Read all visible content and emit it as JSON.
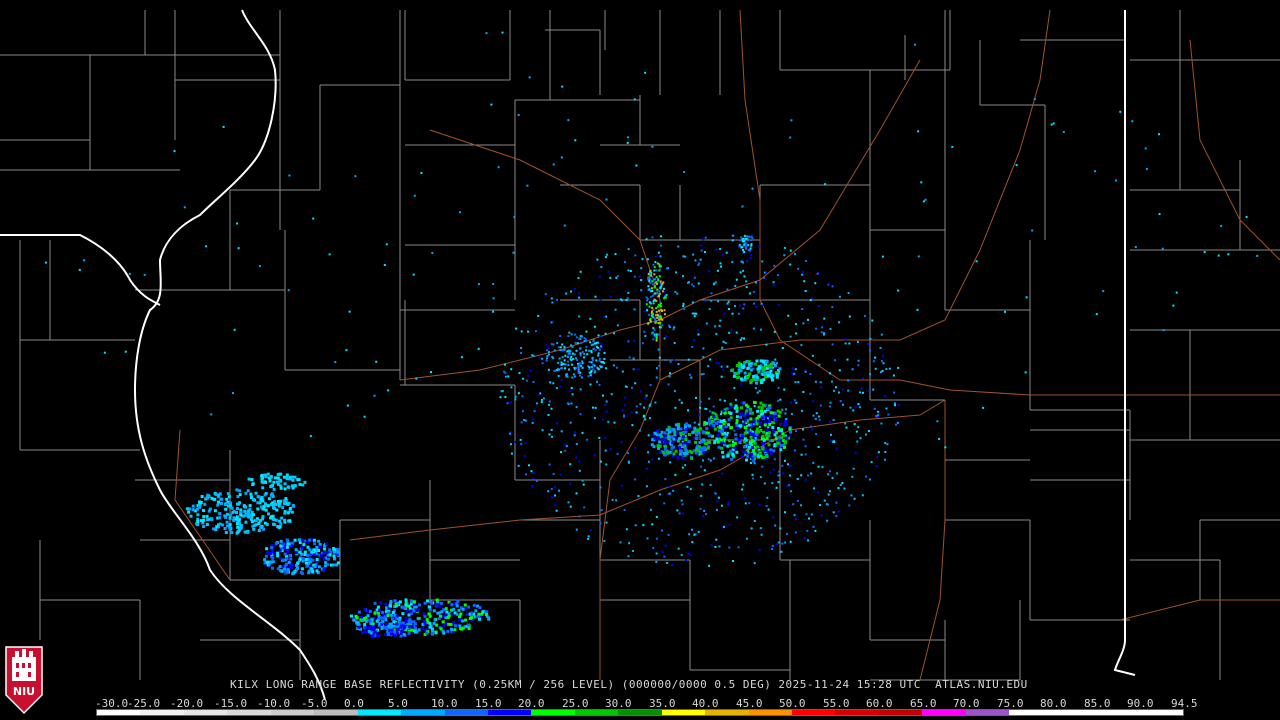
{
  "caption": "KILX LONG RANGE BASE REFLECTIVITY (0.25KM / 256 LEVEL) (000000/0000 0.5 DEG) 2025-11-24 15:28 UTC  ATLAS.NIU.EDU",
  "logo_text": "NIU",
  "colors": {
    "background": "#000000",
    "county_lines": "#8a8a8a",
    "state_lines": "#ffffff",
    "highways": "#a0522d",
    "text": "#d8d8d8"
  },
  "scale": {
    "labels": [
      "-30.0",
      "-25.0",
      "-20.0",
      "-15.0",
      "-10.0",
      "-5.0",
      "0.0",
      "5.0",
      "10.0",
      "15.0",
      "20.0",
      "25.0",
      "30.0",
      "35.0",
      "40.0",
      "45.0",
      "50.0",
      "55.0",
      "60.0",
      "65.0",
      "70.0",
      "75.0",
      "80.0",
      "85.0",
      "90.0",
      "94.5"
    ],
    "colors": [
      "#ffffff",
      "#f2f2f2",
      "#e6e6e6",
      "#d9d9d9",
      "#cccccc",
      "#bdbdbd",
      "#00e8ff",
      "#00a8ff",
      "#1464ff",
      "#0000ff",
      "#00ff00",
      "#00c800",
      "#009000",
      "#ffff00",
      "#e6b400",
      "#ff9000",
      "#ff0000",
      "#d60000",
      "#c00000",
      "#ff00ff",
      "#9955c9",
      "#ffffff",
      "#ffffff",
      "#ffffff",
      "#ffffff"
    ]
  }
}
